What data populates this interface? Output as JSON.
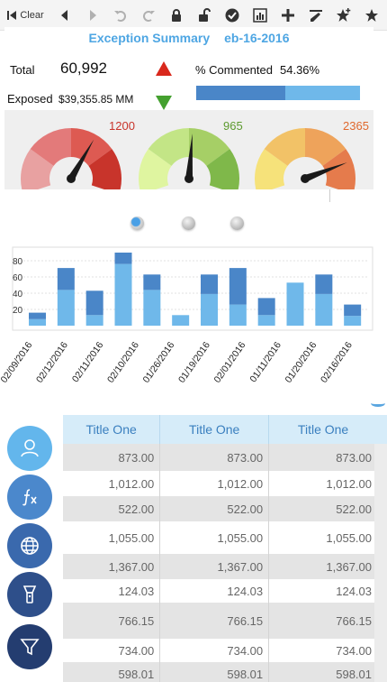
{
  "toolbar": {
    "clear_label": "Clear",
    "icons": [
      "first-page-icon",
      "prev-icon",
      "next-icon",
      "undo-icon",
      "redo-icon",
      "lock-icon",
      "unlock-icon",
      "check-icon",
      "chart-icon",
      "plus-icon",
      "pen-icon",
      "star-plus-icon",
      "star-icon"
    ]
  },
  "summary": {
    "title": "Exception Summary",
    "date": "eb-16-2016",
    "total_label": "Total",
    "total_value": "60,992",
    "exposed_label": "Exposed",
    "exposed_value": "$39,355.85 MM",
    "commented_label": "% Commented",
    "commented_value": "54.36%",
    "commented_fraction": 0.5436,
    "colors": {
      "up": "#d9281c",
      "down": "#44a02f",
      "bar_fill": "#4a86c8",
      "bar_track": "#6fb8ea",
      "title": "#4ea6e3"
    }
  },
  "gauges": [
    {
      "label": "1200",
      "value_fraction": 0.64,
      "label_color": "#c8342b",
      "colors": [
        "#e8a1a1",
        "#e37a7a",
        "#dd5a52",
        "#c8342b"
      ]
    },
    {
      "label": "965",
      "value_fraction": 0.52,
      "label_color": "#5c9a2e",
      "colors": [
        "#dff5a0",
        "#c3e586",
        "#a6cf66",
        "#7fb84a"
      ]
    },
    {
      "label": "2365",
      "value_fraction": 0.82,
      "label_color": "#e0682d",
      "colors": [
        "#f6e27a",
        "#f2c267",
        "#eea35b",
        "#e57b4c"
      ]
    }
  ],
  "pager": {
    "count": 3,
    "active": 0
  },
  "chart_data": {
    "type": "bar",
    "stacked": true,
    "categories": [
      "02/09/2016",
      "02/12/2016",
      "02/11/2016",
      "02/10/2016",
      "01/26/2016",
      "01/19/2016",
      "02/01/2016",
      "01/11/2016",
      "01/20/2016",
      "02/16/2016"
    ],
    "series": [
      {
        "values": [
          8,
          44,
          13,
          76,
          44,
          13,
          39,
          26,
          13,
          53,
          39,
          12
        ],
        "color": "#6fb8ea"
      },
      {
        "values": [
          8,
          27,
          30,
          14,
          19,
          0,
          24,
          45,
          21,
          0,
          24,
          14
        ],
        "color": "#4a86c8"
      }
    ],
    "bar_count": 12,
    "yticks": [
      "80",
      "60",
      "40",
      "20"
    ],
    "ylim": [
      0,
      90
    ],
    "grid": true
  },
  "table": {
    "headers": [
      "Title One",
      "Title One",
      "Title One"
    ],
    "rows": [
      [
        "873.00",
        "873.00",
        "873.00"
      ],
      [
        "1,012.00",
        "1,012.00",
        "1,012.00"
      ],
      [
        "522.00",
        "522.00",
        "522.00"
      ],
      [
        "1,055.00",
        "1,055.00",
        "1,055.00"
      ],
      [
        "1,367.00",
        "1,367.00",
        "1,367.00"
      ],
      [
        "124.03",
        "124.03",
        "124.03"
      ],
      [
        "766.15",
        "766.15",
        "766.15"
      ],
      [
        "734.00",
        "734.00",
        "734.00"
      ],
      [
        "598.01",
        "598.01",
        "598.01"
      ]
    ]
  },
  "side_buttons": [
    {
      "icon": "user-icon",
      "color": "#63b6ec"
    },
    {
      "icon": "function-icon",
      "color": "#4b88cc"
    },
    {
      "icon": "globe-icon",
      "color": "#3a69ad"
    },
    {
      "icon": "flashlight-icon",
      "color": "#2e4f8a"
    },
    {
      "icon": "filter-icon",
      "color": "#243d70"
    }
  ]
}
